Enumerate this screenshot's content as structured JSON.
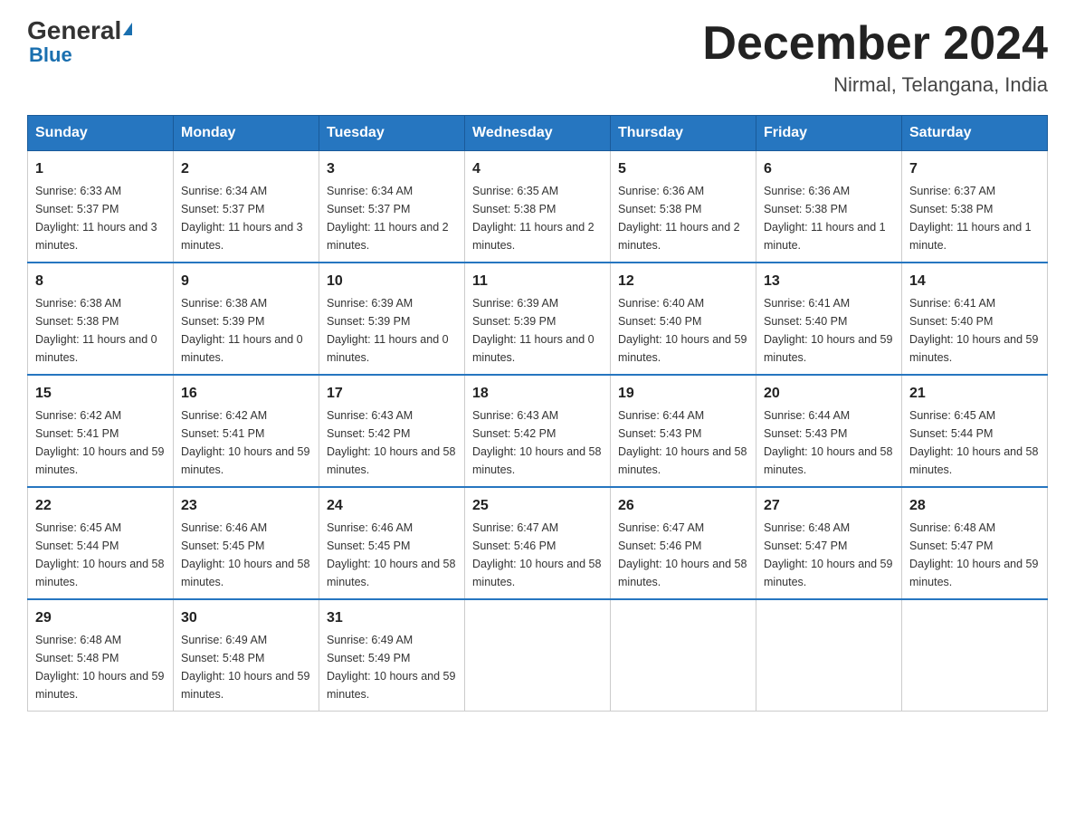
{
  "logo": {
    "name": "General",
    "accent": "Blue"
  },
  "header": {
    "month_title": "December 2024",
    "location": "Nirmal, Telangana, India"
  },
  "weekdays": [
    "Sunday",
    "Monday",
    "Tuesday",
    "Wednesday",
    "Thursday",
    "Friday",
    "Saturday"
  ],
  "weeks": [
    [
      {
        "day": "1",
        "sunrise": "6:33 AM",
        "sunset": "5:37 PM",
        "daylight": "11 hours and 3 minutes."
      },
      {
        "day": "2",
        "sunrise": "6:34 AM",
        "sunset": "5:37 PM",
        "daylight": "11 hours and 3 minutes."
      },
      {
        "day": "3",
        "sunrise": "6:34 AM",
        "sunset": "5:37 PM",
        "daylight": "11 hours and 2 minutes."
      },
      {
        "day": "4",
        "sunrise": "6:35 AM",
        "sunset": "5:38 PM",
        "daylight": "11 hours and 2 minutes."
      },
      {
        "day": "5",
        "sunrise": "6:36 AM",
        "sunset": "5:38 PM",
        "daylight": "11 hours and 2 minutes."
      },
      {
        "day": "6",
        "sunrise": "6:36 AM",
        "sunset": "5:38 PM",
        "daylight": "11 hours and 1 minute."
      },
      {
        "day": "7",
        "sunrise": "6:37 AM",
        "sunset": "5:38 PM",
        "daylight": "11 hours and 1 minute."
      }
    ],
    [
      {
        "day": "8",
        "sunrise": "6:38 AM",
        "sunset": "5:38 PM",
        "daylight": "11 hours and 0 minutes."
      },
      {
        "day": "9",
        "sunrise": "6:38 AM",
        "sunset": "5:39 PM",
        "daylight": "11 hours and 0 minutes."
      },
      {
        "day": "10",
        "sunrise": "6:39 AM",
        "sunset": "5:39 PM",
        "daylight": "11 hours and 0 minutes."
      },
      {
        "day": "11",
        "sunrise": "6:39 AM",
        "sunset": "5:39 PM",
        "daylight": "11 hours and 0 minutes."
      },
      {
        "day": "12",
        "sunrise": "6:40 AM",
        "sunset": "5:40 PM",
        "daylight": "10 hours and 59 minutes."
      },
      {
        "day": "13",
        "sunrise": "6:41 AM",
        "sunset": "5:40 PM",
        "daylight": "10 hours and 59 minutes."
      },
      {
        "day": "14",
        "sunrise": "6:41 AM",
        "sunset": "5:40 PM",
        "daylight": "10 hours and 59 minutes."
      }
    ],
    [
      {
        "day": "15",
        "sunrise": "6:42 AM",
        "sunset": "5:41 PM",
        "daylight": "10 hours and 59 minutes."
      },
      {
        "day": "16",
        "sunrise": "6:42 AM",
        "sunset": "5:41 PM",
        "daylight": "10 hours and 59 minutes."
      },
      {
        "day": "17",
        "sunrise": "6:43 AM",
        "sunset": "5:42 PM",
        "daylight": "10 hours and 58 minutes."
      },
      {
        "day": "18",
        "sunrise": "6:43 AM",
        "sunset": "5:42 PM",
        "daylight": "10 hours and 58 minutes."
      },
      {
        "day": "19",
        "sunrise": "6:44 AM",
        "sunset": "5:43 PM",
        "daylight": "10 hours and 58 minutes."
      },
      {
        "day": "20",
        "sunrise": "6:44 AM",
        "sunset": "5:43 PM",
        "daylight": "10 hours and 58 minutes."
      },
      {
        "day": "21",
        "sunrise": "6:45 AM",
        "sunset": "5:44 PM",
        "daylight": "10 hours and 58 minutes."
      }
    ],
    [
      {
        "day": "22",
        "sunrise": "6:45 AM",
        "sunset": "5:44 PM",
        "daylight": "10 hours and 58 minutes."
      },
      {
        "day": "23",
        "sunrise": "6:46 AM",
        "sunset": "5:45 PM",
        "daylight": "10 hours and 58 minutes."
      },
      {
        "day": "24",
        "sunrise": "6:46 AM",
        "sunset": "5:45 PM",
        "daylight": "10 hours and 58 minutes."
      },
      {
        "day": "25",
        "sunrise": "6:47 AM",
        "sunset": "5:46 PM",
        "daylight": "10 hours and 58 minutes."
      },
      {
        "day": "26",
        "sunrise": "6:47 AM",
        "sunset": "5:46 PM",
        "daylight": "10 hours and 58 minutes."
      },
      {
        "day": "27",
        "sunrise": "6:48 AM",
        "sunset": "5:47 PM",
        "daylight": "10 hours and 59 minutes."
      },
      {
        "day": "28",
        "sunrise": "6:48 AM",
        "sunset": "5:47 PM",
        "daylight": "10 hours and 59 minutes."
      }
    ],
    [
      {
        "day": "29",
        "sunrise": "6:48 AM",
        "sunset": "5:48 PM",
        "daylight": "10 hours and 59 minutes."
      },
      {
        "day": "30",
        "sunrise": "6:49 AM",
        "sunset": "5:48 PM",
        "daylight": "10 hours and 59 minutes."
      },
      {
        "day": "31",
        "sunrise": "6:49 AM",
        "sunset": "5:49 PM",
        "daylight": "10 hours and 59 minutes."
      },
      null,
      null,
      null,
      null
    ]
  ],
  "labels": {
    "sunrise": "Sunrise:",
    "sunset": "Sunset:",
    "daylight": "Daylight:"
  }
}
